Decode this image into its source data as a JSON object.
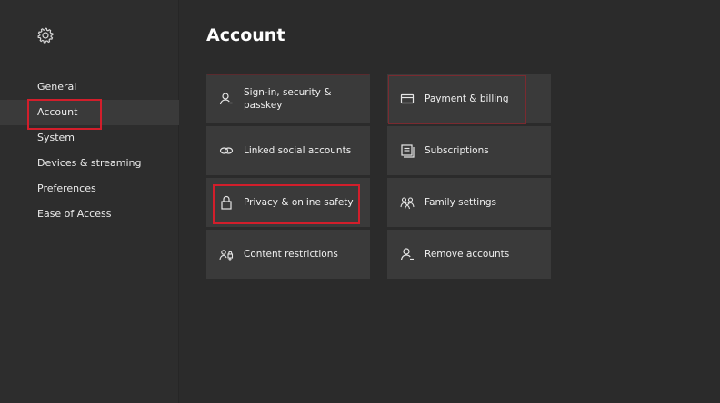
{
  "sidebar": {
    "items": [
      {
        "label": "General"
      },
      {
        "label": "Account"
      },
      {
        "label": "System"
      },
      {
        "label": "Devices & streaming"
      },
      {
        "label": "Preferences"
      },
      {
        "label": "Ease of Access"
      }
    ]
  },
  "main": {
    "title": "Account",
    "tiles": [
      {
        "label": "Sign-in, security & passkey",
        "icon": "person-icon"
      },
      {
        "label": "Payment & billing",
        "icon": "credit-card-icon"
      },
      {
        "label": "Linked social accounts",
        "icon": "link-icon"
      },
      {
        "label": "Subscriptions",
        "icon": "subscriptions-icon"
      },
      {
        "label": "Privacy & online safety",
        "icon": "lock-icon"
      },
      {
        "label": "Family settings",
        "icon": "family-icon"
      },
      {
        "label": "Content restrictions",
        "icon": "content-restrictions-icon"
      },
      {
        "label": "Remove accounts",
        "icon": "remove-person-icon"
      }
    ]
  },
  "colors": {
    "background": "#2b2b2b",
    "tile": "#3a3a3a",
    "highlight": "#d21e2b",
    "text": "#ffffff"
  }
}
